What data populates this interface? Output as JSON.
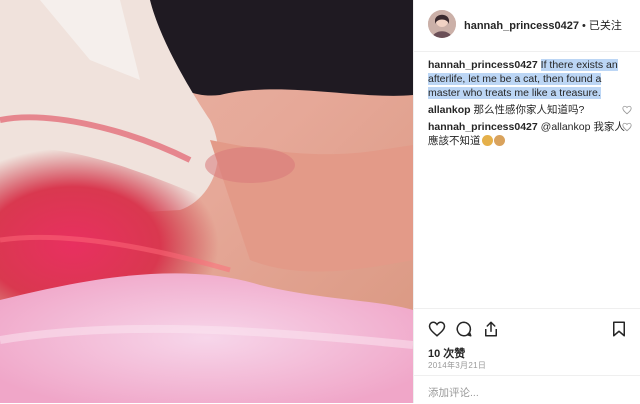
{
  "post": {
    "username": "hannah_princess0427",
    "follow_text": "• 已关注",
    "caption_user": "hannah_princess0427",
    "caption_text": "If there exists an afterlife, let me be a cat, then found a master who treats me like a treasure.",
    "comments": [
      {
        "user": "allankop",
        "text": "那么性感你家人知道吗?"
      },
      {
        "user": "hannah_princess0427",
        "text": "@allankop 我家人應該不知道"
      }
    ],
    "likes": "10 次赞",
    "date": "2014年3月21日",
    "add_comment_placeholder": "添加评论..."
  },
  "icons": [
    "heart-icon",
    "comment-icon",
    "share-icon",
    "bookmark-icon"
  ],
  "colors": {
    "highlight": "#bcd6f5",
    "text": "#262626",
    "muted": "#999999"
  }
}
